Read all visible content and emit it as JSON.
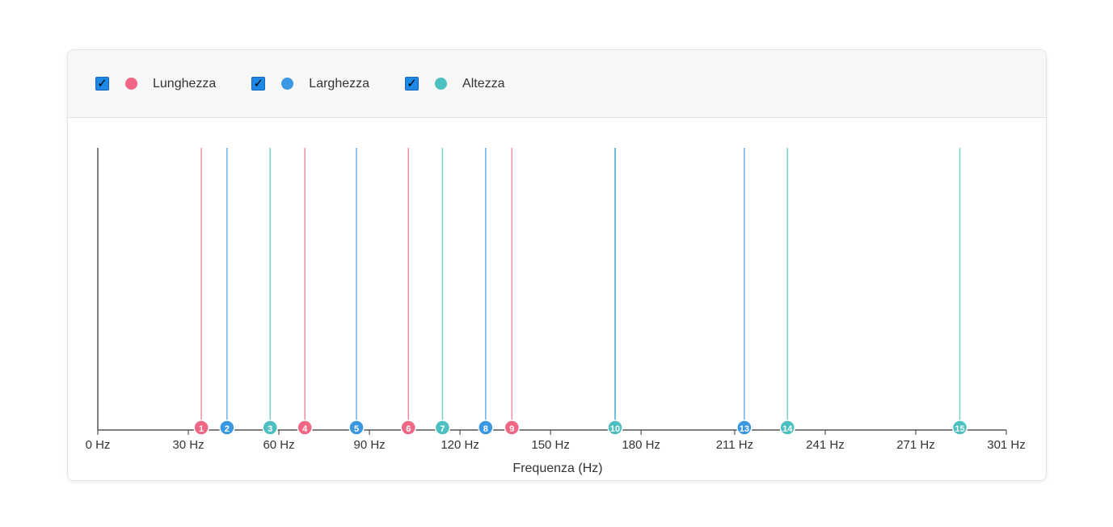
{
  "legend": {
    "items": [
      {
        "label": "Lunghezza",
        "color": "#f06785",
        "checked": true
      },
      {
        "label": "Larghezza",
        "color": "#3a97e2",
        "checked": true
      },
      {
        "label": "Altezza",
        "color": "#4cbfc0",
        "checked": true
      }
    ]
  },
  "chart_data": {
    "type": "scatter",
    "xlabel": "Frequenza (Hz)",
    "xlim": [
      0,
      301
    ],
    "xticks": [
      0,
      30,
      60,
      90,
      120,
      150,
      180,
      211,
      241,
      271,
      301
    ],
    "xtick_labels": [
      "0 Hz",
      "30 Hz",
      "60 Hz",
      "90 Hz",
      "120 Hz",
      "150 Hz",
      "180 Hz",
      "211 Hz",
      "241 Hz",
      "271 Hz",
      "301 Hz"
    ],
    "grid": false,
    "legend_position": "top-left",
    "series": [
      {
        "name": "Lunghezza",
        "color": "#f06785",
        "points": [
          {
            "label": "1",
            "x": 34.3
          },
          {
            "label": "4",
            "x": 68.6
          },
          {
            "label": "6",
            "x": 102.9
          },
          {
            "label": "9",
            "x": 137.2
          }
        ]
      },
      {
        "name": "Larghezza",
        "color": "#3a97e2",
        "points": [
          {
            "label": "2",
            "x": 42.8
          },
          {
            "label": "5",
            "x": 85.7
          },
          {
            "label": "8",
            "x": 128.5
          },
          {
            "label": "13",
            "x": 214.2
          }
        ]
      },
      {
        "name": "Altezza",
        "color": "#4cbfc0",
        "points": [
          {
            "label": "3",
            "x": 57.1
          },
          {
            "label": "7",
            "x": 114.2
          },
          {
            "label": "10",
            "x": 171.4
          },
          {
            "label": "14",
            "x": 228.5
          },
          {
            "label": "15",
            "x": 285.6
          }
        ]
      }
    ],
    "extra_lines": [
      {
        "x": 171.4,
        "color": "#3a97e2"
      }
    ]
  }
}
